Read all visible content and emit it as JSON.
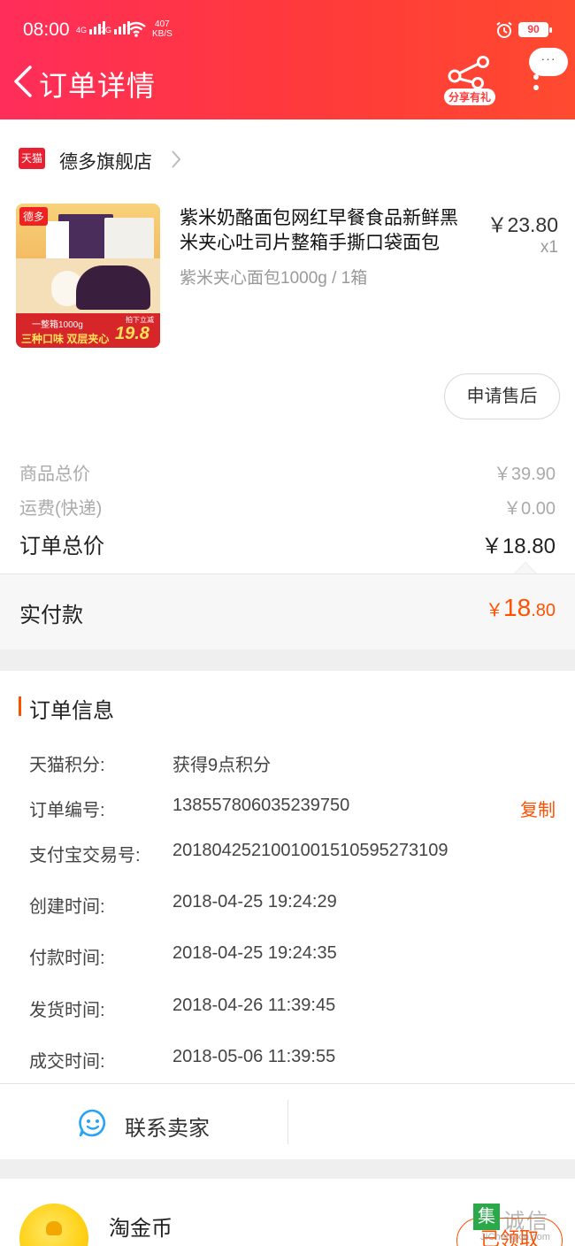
{
  "status_bar": {
    "time": "08:00",
    "net_1": "4G",
    "net_2": "2G",
    "speed_value": "407",
    "speed_unit": "KB/S",
    "battery": "90"
  },
  "header": {
    "title": "订单详情",
    "share_label": "分享有礼",
    "chat_dots": "···"
  },
  "shop": {
    "badge": "天猫",
    "name": "德多旗舰店"
  },
  "product": {
    "thumb_logo": "德多",
    "thumb_banner_a": "一整箱1000g",
    "thumb_banner_b": "三种口味 双层夹心",
    "thumb_price_label": "拍下立减",
    "thumb_price": "19.8",
    "title": "紫米奶酪面包网红早餐食品新鲜黑米夹心吐司片整箱手撕口袋面包",
    "sku": "紫米夹心面包1000g / 1箱",
    "price": "￥23.80",
    "qty": "x1",
    "aftersale_label": "申请售后"
  },
  "totals": {
    "goods_label": "商品总价",
    "goods_value": "￥39.90",
    "shipping_label": "运费(快递)",
    "shipping_value": "￥0.00",
    "order_total_label": "订单总价",
    "order_total_value": "￥18.80",
    "paid_label": "实付款",
    "paid_currency": "￥",
    "paid_int": "18",
    "paid_dec": ".80"
  },
  "order_info": {
    "title": "订单信息",
    "rows": [
      {
        "key": "天猫积分:",
        "value": "获得9点积分"
      },
      {
        "key": "订单编号:",
        "value": "138557806035239750"
      },
      {
        "key": "支付宝交易号:",
        "value": "2018042521001001510595273109"
      },
      {
        "key": "创建时间:",
        "value": "2018-04-25 19:24:29"
      },
      {
        "key": "付款时间:",
        "value": "2018-04-25 19:24:35"
      },
      {
        "key": "发货时间:",
        "value": "2018-04-26 11:39:45"
      },
      {
        "key": "成交时间:",
        "value": "2018-05-06 11:39:55"
      }
    ],
    "copy_label": "复制"
  },
  "contact": {
    "label": "联系卖家"
  },
  "coins": {
    "label": "淘金币",
    "claimed_label": "已领取"
  },
  "watermark": {
    "box": "集",
    "text": "诚信",
    "url": "JIChengxin.com"
  },
  "colors": {
    "header_gradient_start": "#ff2d5a",
    "header_gradient_end": "#ff4a2f",
    "accent_orange": "#ff5000",
    "tmall_red": "#e8202f"
  },
  "icons": {
    "back": "chevron-left-icon",
    "share": "share-icon",
    "more": "more-vertical-icon",
    "shop_arrow": "chevron-right-icon",
    "contact": "chat-face-icon",
    "coin": "gold-coin-icon"
  }
}
